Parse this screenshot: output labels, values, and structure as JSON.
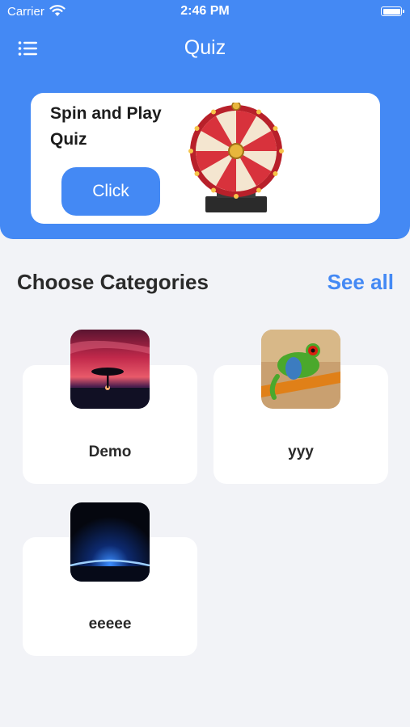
{
  "status_bar": {
    "carrier": "Carrier",
    "time": "2:46 PM"
  },
  "header": {
    "title": "Quiz",
    "menu_icon": "list-menu-icon"
  },
  "promo": {
    "title": "Spin and Play Quiz",
    "button_label": "Click",
    "image_icon": "prize-wheel"
  },
  "section": {
    "title": "Choose Categories",
    "see_all_label": "See all"
  },
  "categories": [
    {
      "label": "Demo",
      "image": "sunset-tree"
    },
    {
      "label": "yyy",
      "image": "tree-frog"
    },
    {
      "label": "eeeee",
      "image": "blue-horizon"
    }
  ],
  "colors": {
    "accent": "#4489f4",
    "background": "#f2f3f7",
    "card": "#ffffff"
  }
}
